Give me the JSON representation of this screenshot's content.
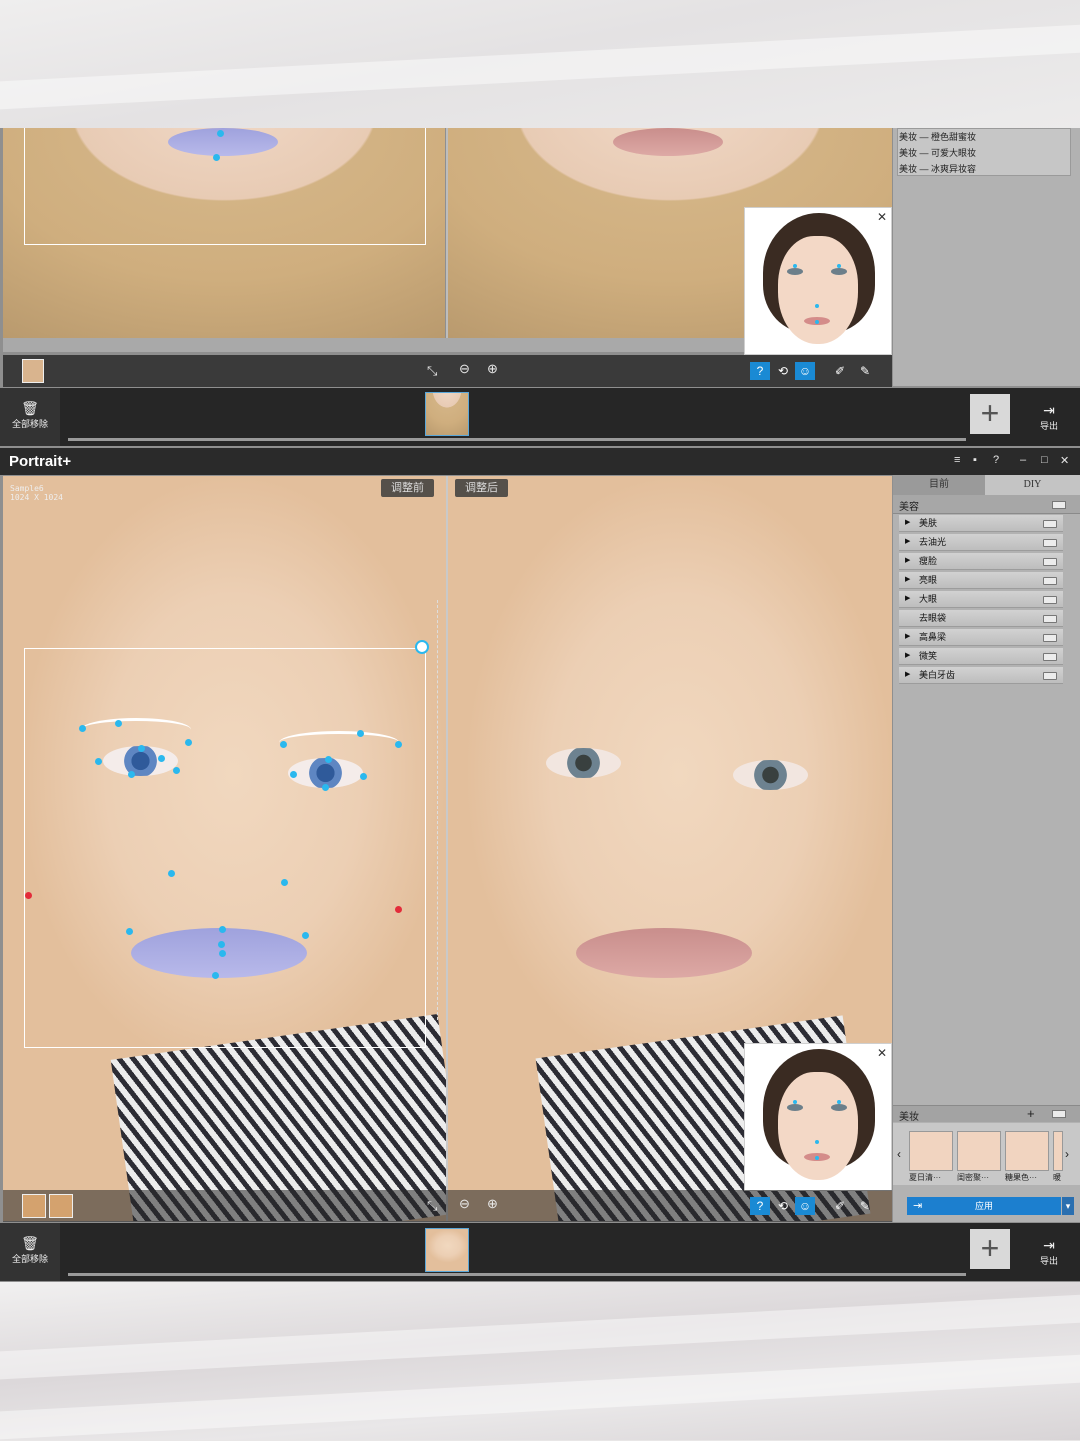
{
  "app": {
    "title": "Portrait+"
  },
  "window_controls": {
    "list": "≡",
    "chat": "▪",
    "help": "?",
    "minimize": "–",
    "maximize": "□",
    "close": "✕"
  },
  "top": {
    "presets": [
      "美妆 — 橙色甜蜜妆",
      "美妆 — 可爱大眼妆",
      "美妆 — 冰爽异妆容"
    ],
    "face_popup_close": "✕",
    "toolbar": {
      "help": "?",
      "refresh": "⟲",
      "smile": "☺",
      "eraser": "✐",
      "brush": "✎",
      "fit": "⤡",
      "zoom_out": "−",
      "zoom_in": "+"
    }
  },
  "bottom_bar": {
    "remove_all_label": "全部移除",
    "remove_all_icon": "trash-icon",
    "add_label": "+",
    "export_label": "导出"
  },
  "main": {
    "meta_line1": "Sample6",
    "meta_line2": "1024 X 1024",
    "before_label": "调整前",
    "after_label": "调整后",
    "face_popup_close": "✕",
    "tabs": {
      "left": "目前",
      "right": "DIY"
    },
    "section_title": "美容",
    "items": [
      {
        "arrow": "▶",
        "label": "美肤"
      },
      {
        "arrow": "▶",
        "label": "去油光"
      },
      {
        "arrow": "▶",
        "label": "瘦脸"
      },
      {
        "arrow": "▶",
        "label": "亮眼"
      },
      {
        "arrow": "▶",
        "label": "大眼"
      },
      {
        "arrow": "",
        "label": "去眼袋"
      },
      {
        "arrow": "▶",
        "label": "高鼻梁"
      },
      {
        "arrow": "▶",
        "label": "微笑"
      },
      {
        "arrow": "▶",
        "label": "美白牙齿"
      }
    ],
    "makeup_title": "美妆",
    "makeup_add": "+",
    "makeup_presets": [
      "夏日清···",
      "闺密聚···",
      "糖果色···",
      "暖"
    ],
    "nav_prev": "‹",
    "nav_next": "›",
    "apply_label": "应用",
    "apply_dropdown": "▾",
    "toolbar": {
      "help": "?",
      "refresh": "⟲",
      "smile": "☺",
      "eraser": "✐",
      "brush": "✎",
      "fit": "⤡",
      "zoom_out": "−",
      "zoom_in": "+"
    }
  },
  "colors": {
    "accent": "#1a8ad4",
    "landmark": "#2ab8ee",
    "landmark_alt": "#e32c3a",
    "panel": "#b2b2b2"
  }
}
